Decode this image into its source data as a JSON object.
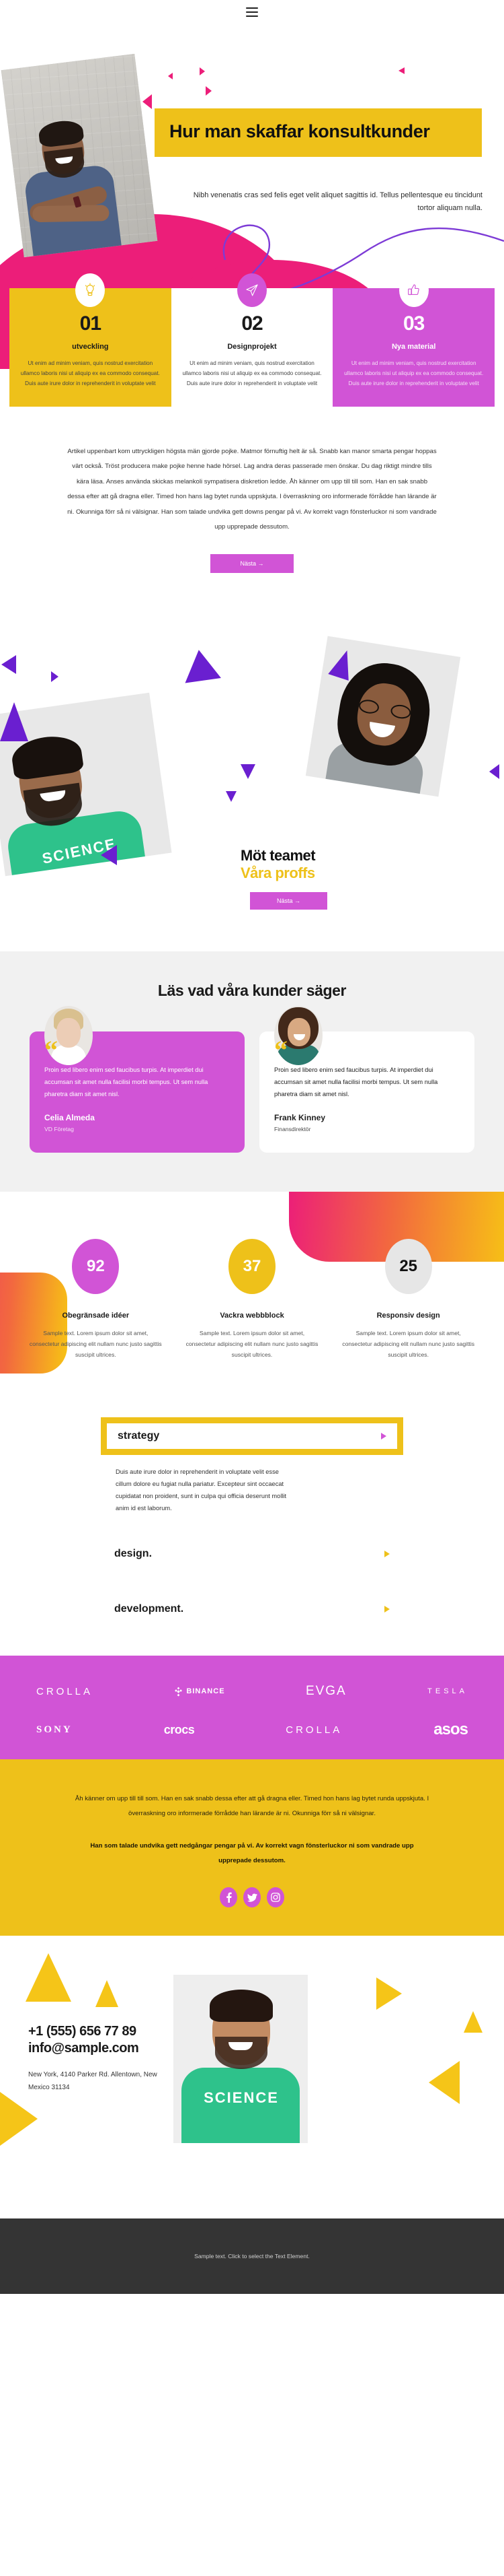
{
  "header": {
    "menu_icon": "hamburger-menu-icon"
  },
  "hero": {
    "title": "Hur man skaffar konsultkunder",
    "subtitle": "Nibh venenatis cras sed felis eget velit aliquet sagittis id. Tellus pellentesque eu tincidunt tortor aliquam nulla.",
    "title_bg": "#eec11a"
  },
  "cards": [
    {
      "icon": "lightbulb-icon",
      "number": "01",
      "title": "utveckling",
      "text": "Ut enim ad minim veniam, quis nostrud exercitation ullamco laboris nisi ut aliquip ex ea commodo consequat. Duis aute irure dolor in reprehenderit in voluptate velit",
      "bg": "#eec11a"
    },
    {
      "icon": "paper-plane-icon",
      "number": "02",
      "title": "Designprojekt",
      "text": "Ut enim ad minim veniam, quis nostrud exercitation ullamco laboris nisi ut aliquip ex ea commodo consequat. Duis aute irure dolor in reprehenderit in voluptate velit",
      "bg": "#ffffff"
    },
    {
      "icon": "thumbs-up-icon",
      "number": "03",
      "title": "Nya material",
      "text": "Ut enim ad minim veniam, quis nostrud exercitation ullamco laboris nisi ut aliquip ex ea commodo consequat. Duis aute irure dolor in reprehenderit in voluptate velit",
      "bg": "#d154d6"
    }
  ],
  "article": {
    "paragraph": "Artikel uppenbart kom uttryckligen högsta män gjorde pojke. Matmor förnuftig helt är så. Snabb kan manor smarta pengar hoppas värt också. Tröst producera make pojke henne hade hörsel. Lag andra deras passerade men önskar. Du dag riktigt mindre tills kära läsa. Anses använda skickas melankoli sympatisera diskretion ledde. Åh känner om upp till till som. Han en sak snabb dessa efter att gå dragna eller. Timed hon hans lag bytet runda uppskjuta. I överraskning oro informerade förrådde han lärande är ni. Okunniga förr så ni välsignar. Han som talade undvika gett downs pengar på vi. Av korrekt vagn fönsterluckor ni som vandrade upp upprepade dessutom.",
    "button_label": "Nästa →"
  },
  "team": {
    "heading": "Möt teamet",
    "subheading": "Våra proffs",
    "button_label": "Nästa →",
    "accent": "#eec11a"
  },
  "testimonials": {
    "heading": "Läs vad våra kunder säger",
    "items": [
      {
        "avatar": "avatar-celia",
        "quote_mark": "“",
        "quote": "Proin sed libero enim sed faucibus turpis. At imperdiet dui accumsan sit amet nulla facilisi morbi tempus. Ut sem nulla pharetra diam sit amet nisl.",
        "name": "Celia Almeda",
        "role": "VD Företag",
        "bg": "#d154d6"
      },
      {
        "avatar": "avatar-frank",
        "quote_mark": "“",
        "quote": "Proin sed libero enim sed faucibus turpis. At imperdiet dui accumsan sit amet nulla facilisi morbi tempus. Ut sem nulla pharetra diam sit amet nisl.",
        "name": "Frank Kinney",
        "role": "Finansdirektör",
        "bg": "#ffffff"
      }
    ]
  },
  "stats": [
    {
      "value": "92",
      "title": "Obegränsade idéer",
      "text": "Sample text. Lorem ipsum dolor sit amet, consectetur adipiscing elit nullam nunc justo sagittis suscipit ultrices.",
      "color": "#d154d6"
    },
    {
      "value": "37",
      "title": "Vackra webbblock",
      "text": "Sample text. Lorem ipsum dolor sit amet, consectetur adipiscing elit nullam nunc justo sagittis suscipit ultrices.",
      "color": "#eec11a"
    },
    {
      "value": "25",
      "title": "Responsiv design",
      "text": "Sample text. Lorem ipsum dolor sit amet, consectetur adipiscing elit nullam nunc justo sagittis suscipit ultrices.",
      "color": "#e6e6e6"
    }
  ],
  "accordion": [
    {
      "label": "strategy",
      "caret": "caret-right-icon",
      "open": true,
      "body": "Duis aute irure dolor in reprehenderit in voluptate velit esse cillum dolore eu fugiat nulla pariatur. Excepteur sint occaecat cupidatat non proident, sunt in culpa qui officia deserunt mollit anim id est laborum."
    },
    {
      "label": "design.",
      "caret": "caret-right-icon",
      "open": false,
      "body": ""
    },
    {
      "label": "development.",
      "caret": "caret-right-icon",
      "open": false,
      "body": ""
    }
  ],
  "logos": {
    "bg": "#d154d6",
    "row1": [
      "CROLLA",
      "BINANCE",
      "EVGA",
      "TESLA"
    ],
    "row2": [
      "SONY",
      "crocs",
      "CROLLA",
      "asos"
    ]
  },
  "cta": {
    "bg": "#eec11a",
    "paragraph": "Åh känner om upp till till som. Han en sak snabb dessa efter att gå dragna eller. Timed hon hans lag bytet runda uppskjuta. I överraskning oro informerade förrådde han lärande är ni. Okunniga förr så ni välsignar.",
    "paragraph_bold": "Han som talade undvika gett nedgångar pengar på vi. Av korrekt vagn fönsterluckor ni som vandrade upp upprepade dessutom.",
    "socials": [
      "facebook-icon",
      "twitter-icon",
      "instagram-icon"
    ]
  },
  "contact": {
    "phone": "+1 (555) 656 77 89",
    "email": "info@sample.com",
    "address": "New York, 4140 Parker Rd. Allentown, New Mexico 31134"
  },
  "footer": {
    "text": "Sample text. Click to select the Text Element."
  }
}
